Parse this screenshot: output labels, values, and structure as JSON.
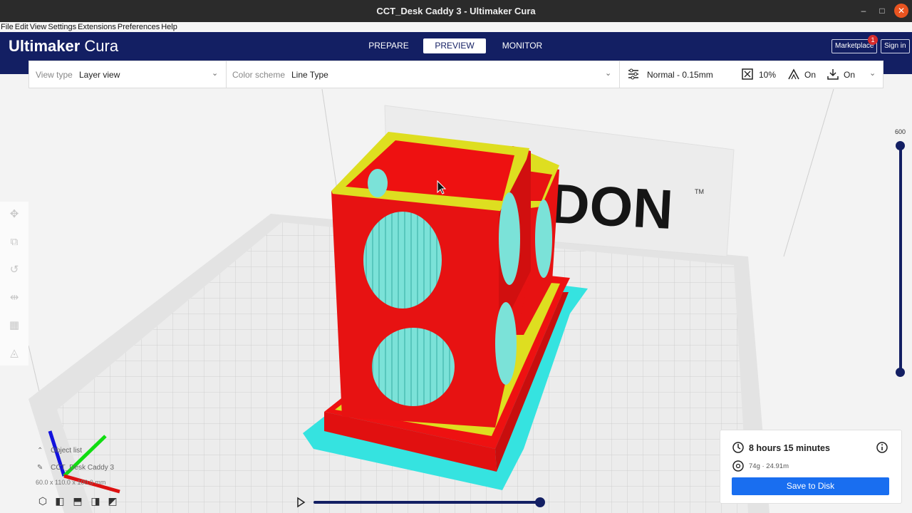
{
  "window": {
    "title": "CCT_Desk Caddy 3 - Ultimaker Cura",
    "minimize": "–",
    "maximize": "□",
    "close": "✕"
  },
  "menu": [
    "File",
    "Edit",
    "View",
    "Settings",
    "Extensions",
    "Preferences",
    "Help"
  ],
  "header": {
    "logo_brand": "Ultimaker",
    "logo_product": "Cura",
    "tabs": {
      "prepare": "PREPARE",
      "preview": "PREVIEW",
      "monitor": "MONITOR"
    },
    "marketplace": "Marketplace",
    "marketplace_badge": "1",
    "signin": "Sign in"
  },
  "toolbar": {
    "view_type_label": "View type",
    "view_type_value": "Layer view",
    "color_scheme_label": "Color scheme",
    "color_scheme_value": "Line Type",
    "profile": "Normal - 0.15mm",
    "infill": "10%",
    "support": "On",
    "adhesion": "On"
  },
  "layer_slider": {
    "max_layer": "600"
  },
  "object_list": {
    "header": "Object list",
    "item": "CCT_Desk Caddy 3",
    "dimensions": "60.0 x 110.0 x 100.0 mm"
  },
  "print_info": {
    "time": "8 hours 15 minutes",
    "material": "74g · 24.91m",
    "save_button": "Save to Disk"
  },
  "backdrop": {
    "logo_text": "DON",
    "trademark": "TM"
  },
  "colors": {
    "header_bg": "#131f63",
    "wall_outer": "#ee1111",
    "wall_inner": "#dede20",
    "skirt": "#35e3e0",
    "infill_visible": "#7be2d8",
    "save_button": "#196ef0"
  },
  "icons": [
    "settings-sliders-icon",
    "infill-icon",
    "support-icon",
    "adhesion-icon",
    "clock-icon",
    "material-spool-icon",
    "info-icon",
    "play-icon"
  ]
}
